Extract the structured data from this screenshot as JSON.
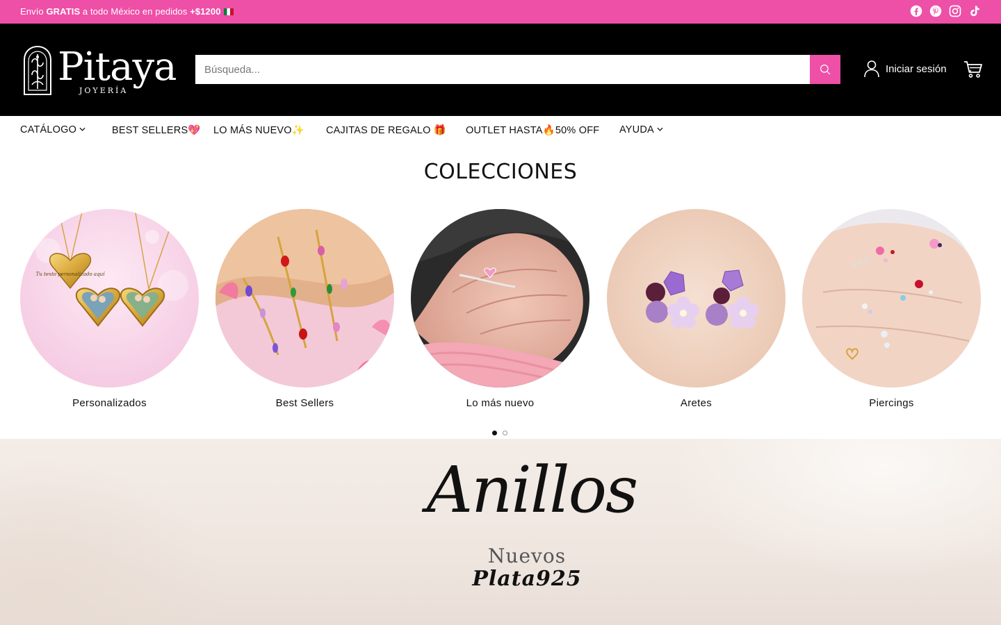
{
  "announcement": {
    "pre": "Envío ",
    "bold1": "GRATIS",
    "mid": " a todo México en pedidos ",
    "bold2": "+$1200",
    "flag_icon": "mexico-flag-icon"
  },
  "socials": [
    "facebook-icon",
    "pinterest-icon",
    "instagram-icon",
    "tiktok-icon"
  ],
  "brand": {
    "name": "Pitaya",
    "sub": "JOYERÍA"
  },
  "search": {
    "placeholder": "Búsqueda..."
  },
  "account": {
    "login_label": "Iniciar sesión"
  },
  "nav": [
    {
      "label": "CATÁLOGO",
      "dropdown": true
    },
    {
      "label": "BEST SELLERS💖",
      "dropdown": false
    },
    {
      "label": "LO MÁS NUEVO✨",
      "dropdown": false
    },
    {
      "label": "CAJITAS DE REGALO 🎁",
      "dropdown": false
    },
    {
      "label": "OUTLET HASTA🔥50% OFF",
      "dropdown": false
    },
    {
      "label": "AYUDA",
      "dropdown": true
    }
  ],
  "collections": {
    "title": "COLECCIONES",
    "items": [
      {
        "label": "Personalizados",
        "image": "heart-locket-necklaces",
        "locket_text": "Tu texto personalizado aquí"
      },
      {
        "label": "Best Sellers",
        "image": "gem-vine-bracelets"
      },
      {
        "label": "Lo más nuevo",
        "image": "heart-gem-ring-on-hand"
      },
      {
        "label": "Aretes",
        "image": "purple-flower-earrings"
      },
      {
        "label": "Piercings",
        "image": "piercings-in-palm"
      }
    ],
    "pages": 2,
    "active_page": 1
  },
  "banner": {
    "title": "Anillos",
    "line1": "Nuevos",
    "line2": "Plata925"
  },
  "colors": {
    "accent": "#ee4fa7",
    "header_bg": "#000000"
  }
}
